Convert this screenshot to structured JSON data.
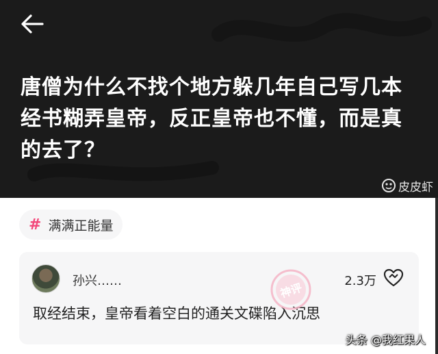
{
  "header": {
    "back_icon": "back-arrow-icon",
    "title": "唐僧为什么不找个地方躲几年自己写几本经书糊弄皇帝，反正皇帝也不懂，而是真的去了？",
    "brand_name": "皮皮虾",
    "brand_icon": "shrimp-logo-icon"
  },
  "tag": {
    "icon": "#",
    "label": "满满正能量"
  },
  "comment": {
    "username": "孙兴……",
    "like_count": "2.3万",
    "text": "取经结束，皇帝看着空白的通关文碟陷入沉思",
    "stamp_text": "神评"
  },
  "watermark": "头条 @我红果人",
  "colors": {
    "header_bg": "#1b1b1b",
    "accent_pink": "#f3477a",
    "card_bg": "#f6f6f7"
  }
}
